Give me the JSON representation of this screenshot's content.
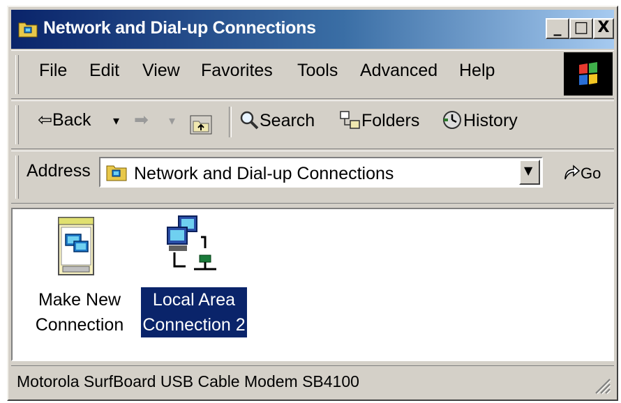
{
  "window": {
    "title": "Network and Dial-up Connections",
    "controls": {
      "minimize": "_",
      "maximize": "□",
      "close": "X"
    }
  },
  "menu": {
    "items": [
      "File",
      "Edit",
      "View",
      "Favorites",
      "Tools",
      "Advanced",
      "Help"
    ]
  },
  "toolbar": {
    "back_label": "Back",
    "search_label": "Search",
    "folders_label": "Folders",
    "history_label": "History"
  },
  "address": {
    "label": "Address",
    "value": "Network and Dial-up Connections",
    "go_label": "Go"
  },
  "content": {
    "items": [
      {
        "line1": "Make New",
        "line2": "Connection",
        "icon": "make-new-connection-icon",
        "selected": false
      },
      {
        "line1": "Local Area",
        "line2": "Connection 2",
        "icon": "network-computers-icon",
        "selected": true
      }
    ]
  },
  "status": {
    "text": "Motorola SurfBoard USB Cable Modem SB4100"
  },
  "colors": {
    "titlebar_start": "#0a246a",
    "titlebar_end": "#a6caf0",
    "selection": "#0a246a",
    "face": "#d4d0c8"
  }
}
